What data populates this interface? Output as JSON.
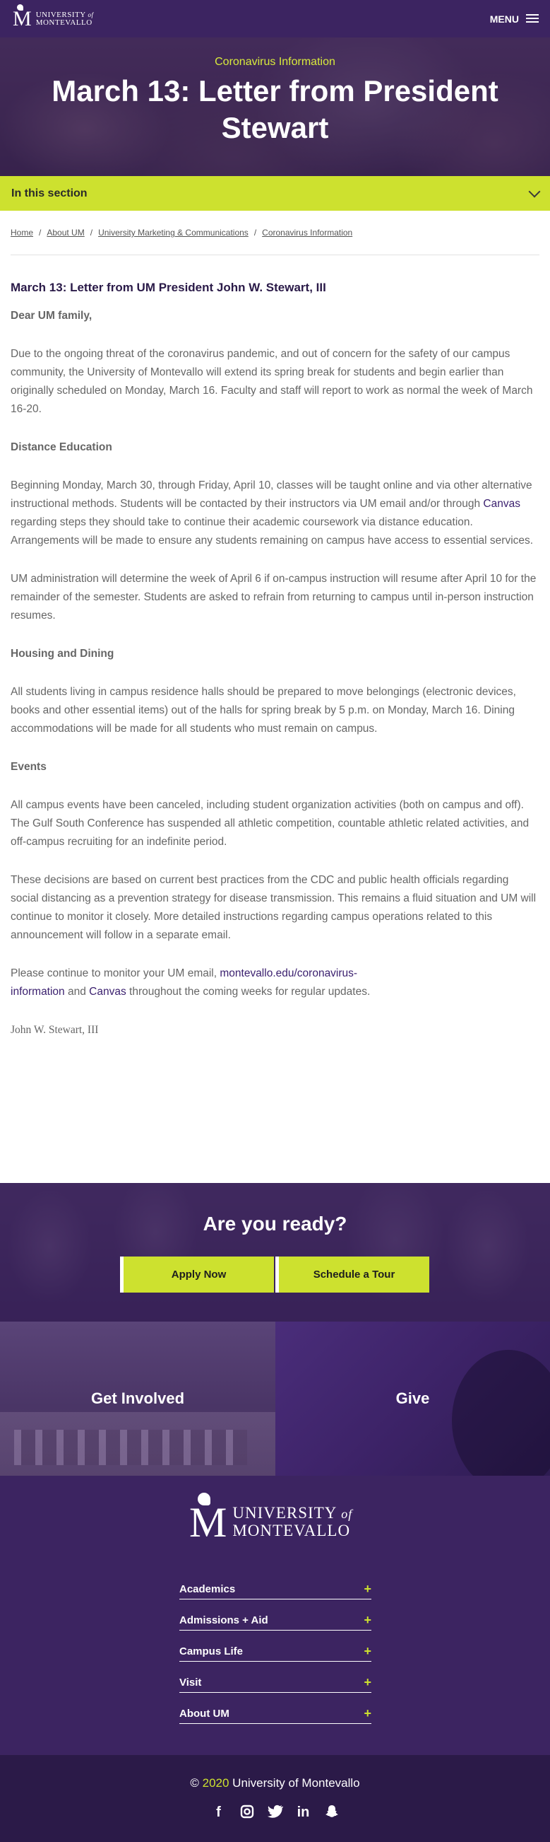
{
  "nav": {
    "logo_letter": "M",
    "logo_line1": "UNIVERSITY",
    "logo_of": "of",
    "logo_line2": "MONTEVALLO",
    "menu_label": "MENU"
  },
  "hero": {
    "subtitle": "Coronavirus Information",
    "title": "March 13: Letter from President Stewart"
  },
  "section_bar": {
    "label": "In this section"
  },
  "breadcrumb": [
    "Home",
    "About UM",
    "University Marketing & Communications",
    "Coronavirus Information"
  ],
  "article": {
    "heading": "March 13: Letter from UM President John W. Stewart, III",
    "greeting": "Dear UM family,",
    "p1": "Due to the ongoing threat of the coronavirus pandemic, and out of concern for the safety of our campus community, the University of Montevallo will extend its spring break for students and begin earlier than originally scheduled on Monday, March 16. Faculty and staff will report to work as normal the week of March 16-20.",
    "h_distance": "Distance Education",
    "p2_a": "Beginning Monday, March 30, through Friday, April 10, classes will be taught online and via other alternative instructional methods. Students will be contacted by their instructors via UM email and/or through ",
    "p2_link": "Canvas",
    "p2_b": " regarding steps they should take to continue their academic coursework via distance education. Arrangements will be made to ensure any students remaining on campus have access to essential services.",
    "p3": "UM administration will determine the week of April 6 if on-campus instruction will resume after April 10 for the remainder of the semester. Students are asked to refrain from returning to campus until in-person instruction resumes.",
    "h_housing": "Housing and Dining",
    "p4": "All students living in campus residence halls should be prepared to move belongings (electronic devices, books and other essential items) out of the halls for spring break by 5 p.m. on Monday, March 16. Dining accommodations will be made for all students who must remain on campus.",
    "h_events": "Events",
    "p5": "All campus events have been canceled, including student organization activities (both on campus and off). The Gulf South Conference has suspended all athletic competition, countable athletic related activities, and off-campus recruiting for an indefinite period.",
    "p6": "These decisions are based on current best practices from the CDC and public health officials regarding social distancing as a prevention strategy for disease transmission. This remains a fluid situation and UM will continue to monitor it closely. More detailed instructions regarding campus operations related to this announcement will follow in a separate email.",
    "p7_a": "Please continue to monitor your UM email, ",
    "p7_link1": "montevallo.edu/coronavirus-information",
    "p7_and": " and ",
    "p7_link2": "Canvas",
    "p7_b": " throughout the coming weeks for regular updates.",
    "signature": "John W. Stewart, III"
  },
  "cta": {
    "title": "Are you ready?",
    "apply": "Apply Now",
    "tour": "Schedule a Tour"
  },
  "tiles": {
    "involved": "Get Involved",
    "give": "Give"
  },
  "footer": {
    "logo_letter": "M",
    "logo_line1": "UNIVERSITY",
    "logo_of": "of",
    "logo_line2": "MONTEVALLO",
    "items": [
      "Academics",
      "Admissions + Aid",
      "Campus Life",
      "Visit",
      "About UM"
    ],
    "plus": "+",
    "copyright_symbol": "©",
    "year": "2020",
    "copyright_name": "University of Montevallo",
    "social": [
      "facebook-icon",
      "instagram-icon",
      "twitter-icon",
      "linkedin-icon",
      "snapchat-icon"
    ]
  },
  "colors": {
    "purple": "#3c2461",
    "lime": "#cde12f",
    "dark": "#2b1a48"
  }
}
